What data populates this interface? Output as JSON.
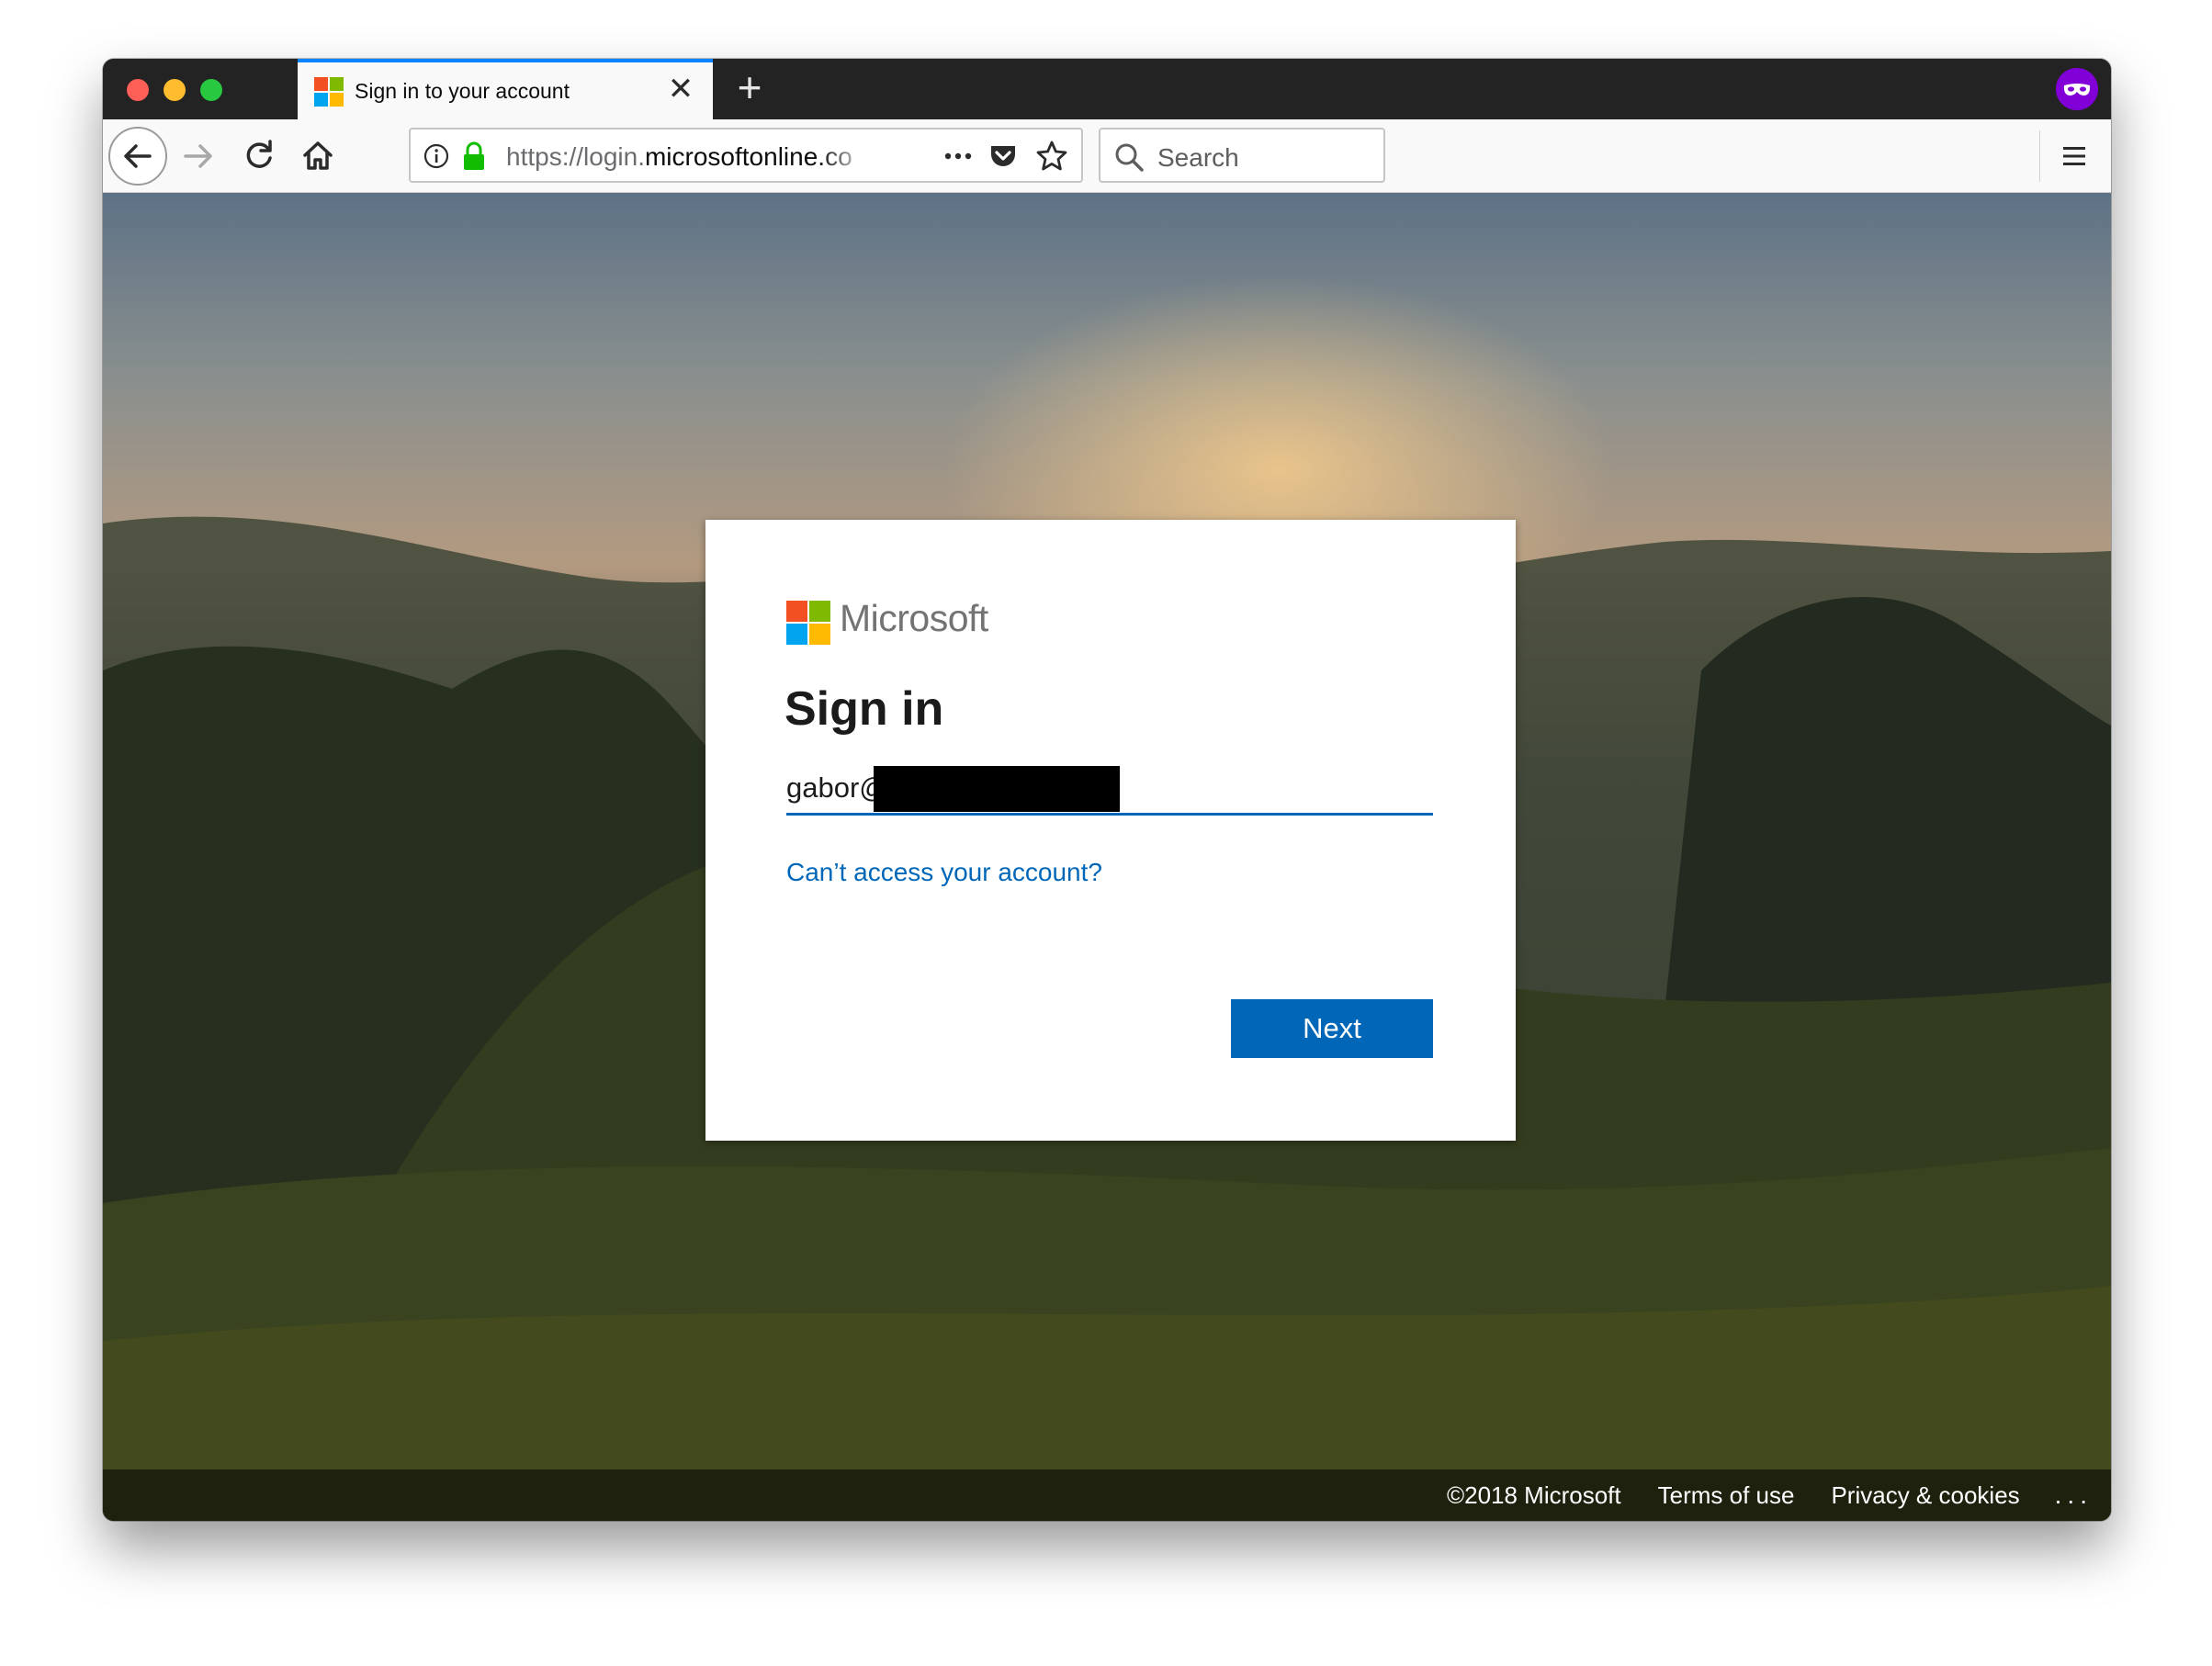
{
  "browser": {
    "tab": {
      "title": "Sign in to your account",
      "close_glyph": "✕",
      "favicon": "microsoft-logo-icon"
    },
    "new_tab_glyph": "+",
    "url": {
      "prefix": "https://login.",
      "domain": "microsoftonline.co"
    },
    "search_placeholder": "Search",
    "private_badge": "private-browsing-mask-icon",
    "colors": {
      "tab_accent": "#0a84ff",
      "secure_lock": "#12bc00",
      "private_badge": "#8000d7"
    }
  },
  "signin": {
    "brand": "Microsoft",
    "title": "Sign in",
    "email_value": "gabor@",
    "cant_access_link": "Can’t access your account?",
    "next_button": "Next",
    "colors": {
      "accent": "#0067b8",
      "ms_red": "#f25022",
      "ms_green": "#7fba00",
      "ms_blue": "#00a4ef",
      "ms_yellow": "#ffb900"
    }
  },
  "footer": {
    "copyright": "©2018 Microsoft",
    "terms": "Terms of use",
    "privacy": "Privacy & cookies",
    "more": "..."
  }
}
